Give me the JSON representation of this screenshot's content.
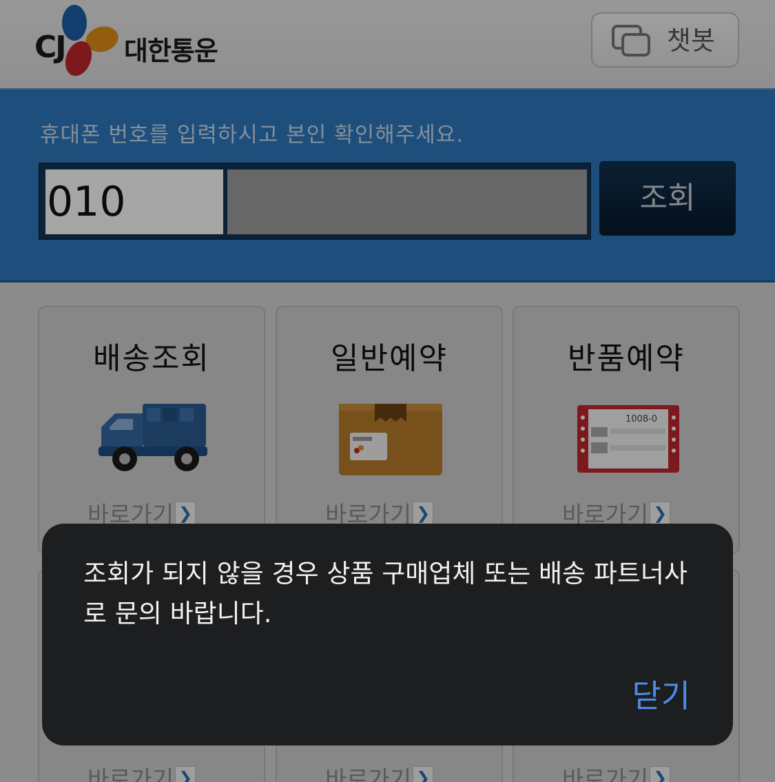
{
  "header": {
    "logo_brand": "CJ",
    "logo_name": "대한통운",
    "chatbot_label": "챗봇"
  },
  "phone": {
    "instruction": "휴대폰 번호를 입력하시고 본인 확인해주세요.",
    "prefix_value": "010",
    "number_value": "",
    "search_label": "조회"
  },
  "menu": {
    "items": [
      {
        "title": "배송조회",
        "goto": "바로가기",
        "icon": "truck-icon"
      },
      {
        "title": "일반예약",
        "goto": "바로가기",
        "icon": "box-icon"
      },
      {
        "title": "반품예약",
        "goto": "바로가기",
        "icon": "return-slip-icon"
      }
    ],
    "bottom_goto": [
      "바로가기",
      "바로가기",
      "바로가기"
    ]
  },
  "slip_number": "1008-0",
  "dialog": {
    "message": "조회가 되지 않을 경우 상품 구매업체 또는 배송 파트너사로 문의 바랍니다.",
    "close_label": "닫기"
  },
  "colors": {
    "panel_blue": "#2e79bd",
    "button_navy": "#0a2238",
    "dialog_bg": "#1d1e20",
    "link_blue": "#4a8de6"
  }
}
